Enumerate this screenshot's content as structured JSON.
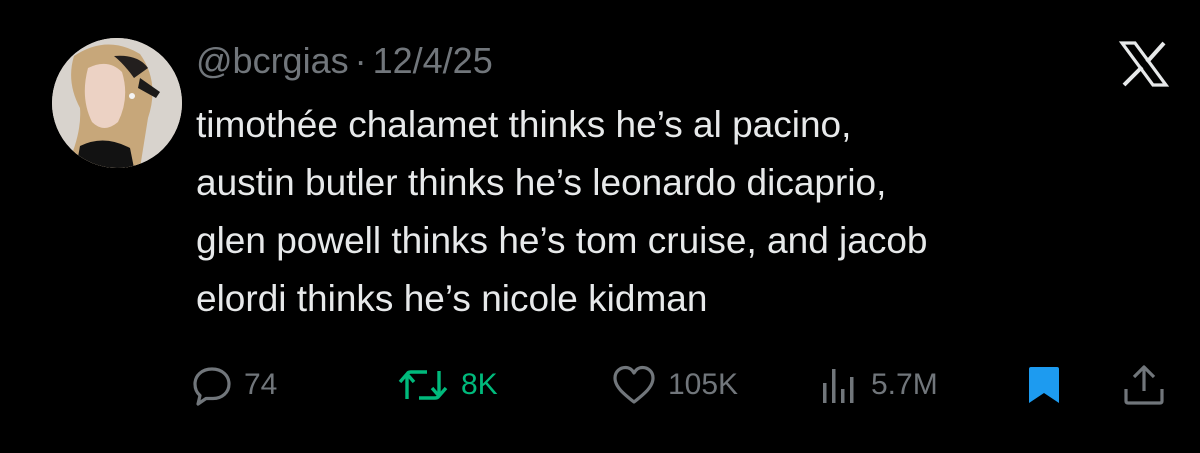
{
  "tweet": {
    "handle": "@bcrgias",
    "separator": "·",
    "date": "12/4/25",
    "text": "timothée chalamet thinks he’s al pacino,\naustin butler thinks he’s leonardo dicaprio,\nglen powell thinks he’s tom cruise, and jacob\nelordi thinks he’s nicole kidman"
  },
  "actions": {
    "replies": "74",
    "reposts": "8K",
    "likes": "105K",
    "views": "5.7M"
  },
  "icons": {
    "reply": "reply-icon",
    "repost": "repost-icon",
    "like": "heart-icon",
    "views": "views-icon",
    "bookmark": "bookmark-icon",
    "share": "share-icon",
    "logo": "x-logo-icon"
  },
  "colors": {
    "background": "#000000",
    "text": "#e7e9ea",
    "muted": "#71767b",
    "repost": "#00ba7c",
    "bookmark": "#1d9bf0"
  }
}
